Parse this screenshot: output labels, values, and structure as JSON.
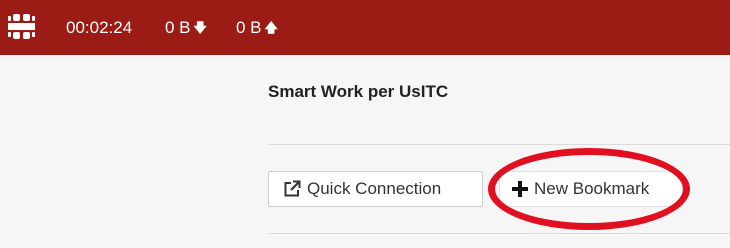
{
  "header": {
    "session_time": "00:02:24",
    "download": "0 B",
    "upload": "0 B",
    "background_color": "#9a1c14",
    "logo_icon": "fortinet-logo-icon",
    "download_icon": "arrow-down-icon",
    "upload_icon": "arrow-up-icon"
  },
  "main": {
    "title": "Smart Work per UsITC",
    "quick_connection_label": "Quick Connection",
    "quick_connection_icon": "external-link-icon",
    "new_bookmark_label": "New Bookmark",
    "new_bookmark_icon": "plus-icon",
    "annotation_color": "#e01020"
  }
}
